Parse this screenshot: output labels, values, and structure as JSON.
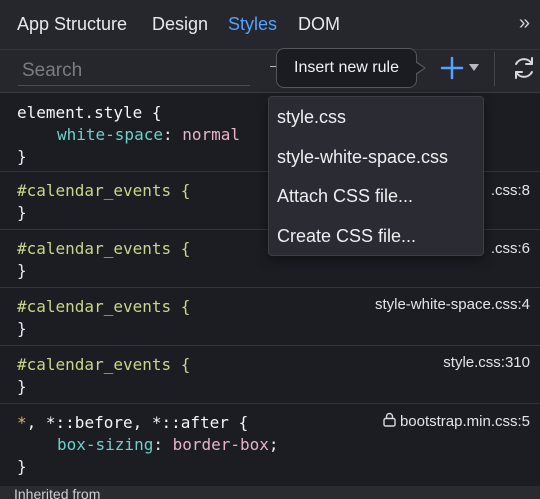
{
  "tabs": [
    "App Structure",
    "Design",
    "Styles",
    "DOM"
  ],
  "active_tab": "Styles",
  "overflow_glyph": "»",
  "search": {
    "placeholder": "Search",
    "value": ""
  },
  "tooltip": "Insert new rule",
  "icons": {
    "add": "plus-icon",
    "add_dropdown": "chevron-down-icon",
    "refresh": "refresh-icon",
    "lock": "lock-icon",
    "overflow": "double-chevron-right-icon"
  },
  "colors": {
    "accent": "#56a0ff",
    "selector_id": "#c9d58a",
    "property": "#6cd0c8",
    "value": "#e8b3c6"
  },
  "menu": [
    "style.css",
    "style-white-space.css",
    "Attach CSS file...",
    "Create CSS file..."
  ],
  "rules": [
    {
      "selector": "element.style {",
      "declaration_prop": "white-space",
      "declaration_value": "normal",
      "close": "}",
      "source": ""
    },
    {
      "selector": "#calendar_events {",
      "close": "}",
      "source": ".css:8"
    },
    {
      "selector": "#calendar_events {",
      "close": "}",
      "source": ".css:6"
    },
    {
      "selector": "#calendar_events {",
      "close": "}",
      "source": "style-white-space.css:4"
    },
    {
      "selector": "#calendar_events {",
      "close": "}",
      "source": "style.css:310"
    },
    {
      "selector_star": "*",
      "selector_rest": ", *::before, *::after {",
      "declaration_prop": "box-sizing",
      "declaration_value": "border-box",
      "close": "}",
      "source": "bootstrap.min.css:5"
    }
  ],
  "inherited_label": "Inherited from"
}
